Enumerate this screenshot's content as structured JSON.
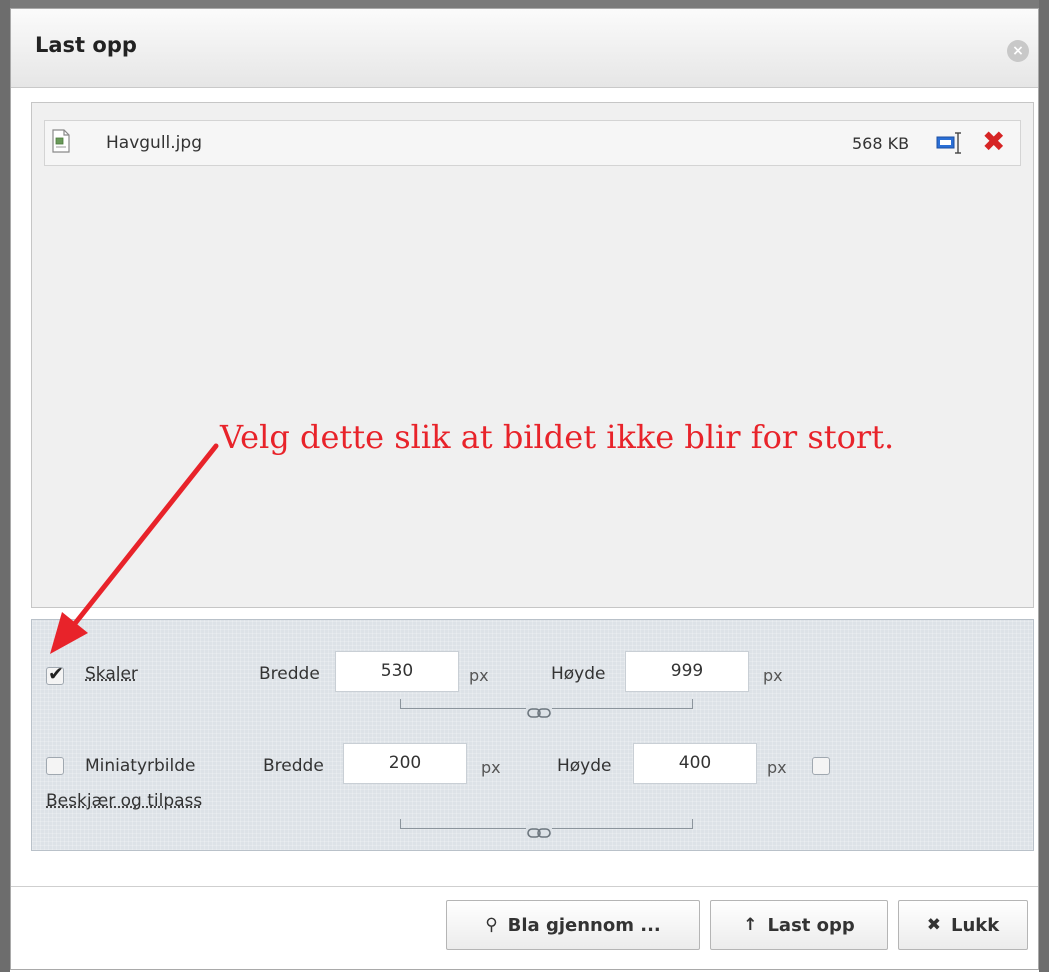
{
  "dialog": {
    "title": "Last opp",
    "close_icon": "close-circle-icon"
  },
  "file": {
    "name": "Havgull.jpg",
    "size": "568 KB",
    "file_icon": "image-file-icon",
    "resize_icon": "resize-icon",
    "delete_icon": "delete-x-icon",
    "delete_color": "#d62424"
  },
  "annotation": {
    "text": "Velg dette slik at bildet ikke blir for stort.",
    "color": "#e8232a"
  },
  "scale": {
    "checked": true,
    "label": "Skaler",
    "width_label": "Bredde",
    "width_value": "530",
    "width_unit": "px",
    "height_label": "Høyde",
    "height_value": "999",
    "height_unit": "px"
  },
  "thumbnail": {
    "checked": false,
    "label": "Miniatyrbilde",
    "width_label": "Bredde",
    "width_value": "200",
    "width_unit": "px",
    "height_label": "Høyde",
    "height_value": "400",
    "height_unit": "px",
    "crop_checked": false,
    "crop_label": "Beskjær og tilpass"
  },
  "buttons": {
    "browse": {
      "icon": "⚲",
      "label": "Bla gjennom ..."
    },
    "upload": {
      "icon": "↑",
      "label": "Last opp"
    },
    "close": {
      "icon": "✖",
      "label": "Lukk"
    }
  }
}
